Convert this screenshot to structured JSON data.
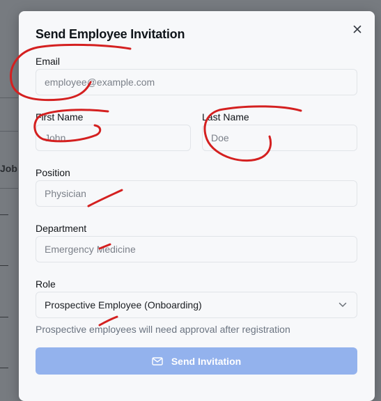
{
  "background": {
    "partial_text": "Job"
  },
  "modal": {
    "title": "Send Employee Invitation",
    "close_icon": "close-icon",
    "email": {
      "label": "Email",
      "placeholder": "employee@example.com"
    },
    "first_name": {
      "label": "First Name",
      "placeholder": "John"
    },
    "last_name": {
      "label": "Last Name",
      "placeholder": "Doe"
    },
    "position": {
      "label": "Position",
      "placeholder": "Physician"
    },
    "department": {
      "label": "Department",
      "placeholder": "Emergency Medicine"
    },
    "role": {
      "label": "Role",
      "selected": "Prospective Employee (Onboarding)",
      "dropdown_icon": "chevron-down-icon"
    },
    "hint": "Prospective employees will need approval after registration",
    "submit": {
      "label": "Send Invitation",
      "icon": "mail-icon"
    }
  },
  "annotation_color": "#d42020"
}
